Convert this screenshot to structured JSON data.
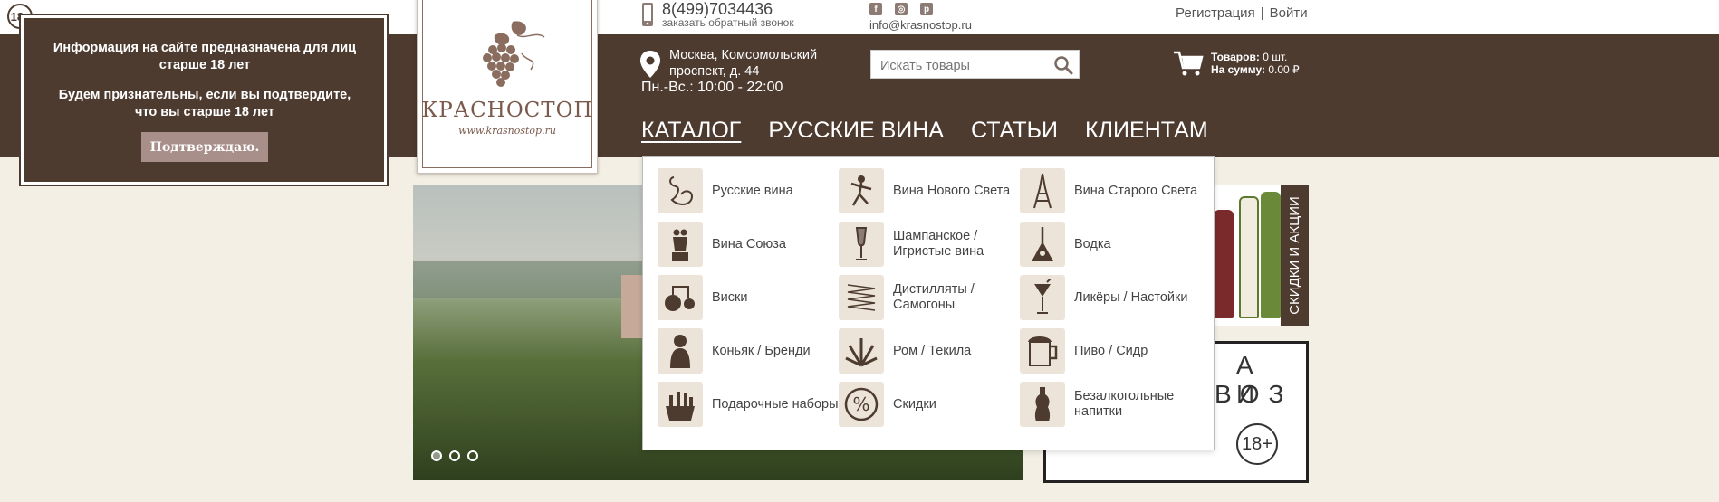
{
  "age_badge": {
    "text": "18",
    "plus": "+"
  },
  "age_popup": {
    "line1": "Информация на сайте предназначена для лиц старше 18 лет",
    "line2": "Будем признательны, если вы подтвердите, что вы старше 18 лет",
    "confirm_label": "Подтверждаю."
  },
  "logo": {
    "name": "КРАСНОСТОП",
    "url": "www.krasnostop.ru"
  },
  "header": {
    "phone": "8(499)7034436",
    "callback": "заказать обратный звонок",
    "email": "info@krasnostop.ru",
    "register": "Регистрация",
    "separator": "|",
    "login": "Войти"
  },
  "social": [
    {
      "icon": "facebook-icon",
      "glyph": "f"
    },
    {
      "icon": "instagram-icon",
      "glyph": "◎"
    },
    {
      "icon": "pinterest-icon",
      "glyph": "p"
    }
  ],
  "store": {
    "address": "Москва, Комсомольский проспект, д. 44",
    "hours": "Пн.-Вс.: 10:00 - 22:00"
  },
  "search": {
    "placeholder": "Искать товары"
  },
  "cart": {
    "items_label": "Товаров:",
    "items_value": "0 шт.",
    "sum_label": "На сумму:",
    "sum_value": "0.00 ₽"
  },
  "menu": [
    {
      "label": "КАТАЛОГ",
      "active": true
    },
    {
      "label": "РУССКИЕ ВИНА",
      "active": false
    },
    {
      "label": "СТАТЬИ",
      "active": false
    },
    {
      "label": "КЛИЕНТАМ",
      "active": false
    }
  ],
  "catalog": [
    {
      "label": "Русские вина",
      "icon": "swan-icon"
    },
    {
      "label": "Вина Нового Света",
      "icon": "dancer-icon"
    },
    {
      "label": "Вина Старого Света",
      "icon": "eiffel-tower-icon"
    },
    {
      "label": "Вина Союза",
      "icon": "monument-icon"
    },
    {
      "label": "Шампанское / Игристые вина",
      "icon": "champagne-glass-icon"
    },
    {
      "label": "Водка",
      "icon": "balalaika-icon"
    },
    {
      "label": "Виски",
      "icon": "still-icon"
    },
    {
      "label": "Дистилляты / Самогоны",
      "icon": "coil-icon"
    },
    {
      "label": "Ликёры / Настойки",
      "icon": "cocktail-icon"
    },
    {
      "label": "Коньяк / Бренди",
      "icon": "bust-icon"
    },
    {
      "label": "Ром / Текила",
      "icon": "agave-icon"
    },
    {
      "label": "Пиво / Сидр",
      "icon": "beer-mug-icon"
    },
    {
      "label": "Подарочные наборы",
      "icon": "gift-basket-icon"
    },
    {
      "label": "Скидки",
      "icon": "percent-icon"
    },
    {
      "label": "Безалкогольные напитки",
      "icon": "soda-bottle-icon"
    }
  ],
  "promo": {
    "tag": "СКИДКИ И АКЦИИ",
    "big1": "А И",
    "big2": "ВОЗ",
    "age": "18+"
  },
  "slider": {
    "active_dot": 0,
    "dots": 3
  },
  "colors": {
    "brand_brown": "#4e3b30",
    "background": "#f3efe4",
    "confirm": "#a98f89"
  }
}
